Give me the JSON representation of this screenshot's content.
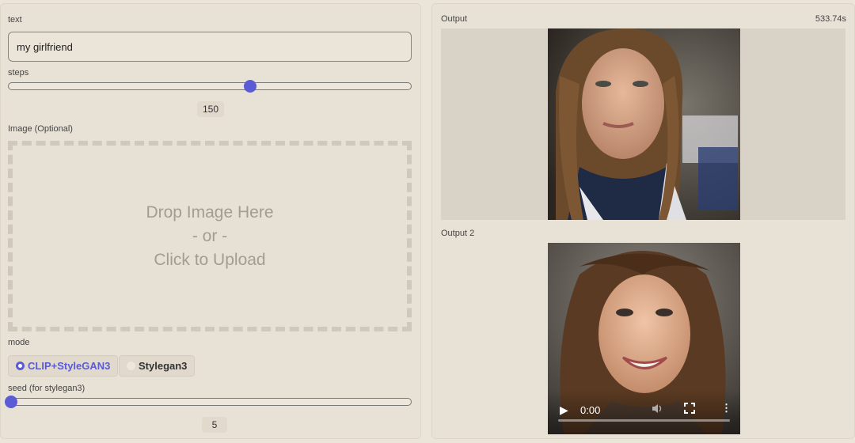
{
  "inputs": {
    "text": {
      "label": "text",
      "value": "my girlfriend"
    },
    "steps": {
      "label": "steps",
      "value": 150,
      "display": "150",
      "min": 0,
      "max": 250
    },
    "image": {
      "label": "Image (Optional)",
      "drop_line1": "Drop Image Here",
      "drop_line2": "- or -",
      "drop_line3": "Click to Upload"
    },
    "mode": {
      "label": "mode",
      "options": [
        "CLIP+StyleGAN3",
        "Stylegan3"
      ],
      "selected": "CLIP+StyleGAN3"
    },
    "seed": {
      "label": "seed (for stylegan3)",
      "value": 5,
      "display": "5",
      "min": 0,
      "max": 1000
    }
  },
  "outputs": {
    "output1": {
      "label": "Output",
      "timer": "533.74s"
    },
    "output2": {
      "label": "Output 2",
      "video_time": "0:00"
    }
  },
  "colors": {
    "accent": "#5b5bd6",
    "background": "#ebe4d9"
  },
  "icons": [
    "play-icon",
    "volume-icon",
    "fullscreen-icon",
    "more-options-icon"
  ]
}
